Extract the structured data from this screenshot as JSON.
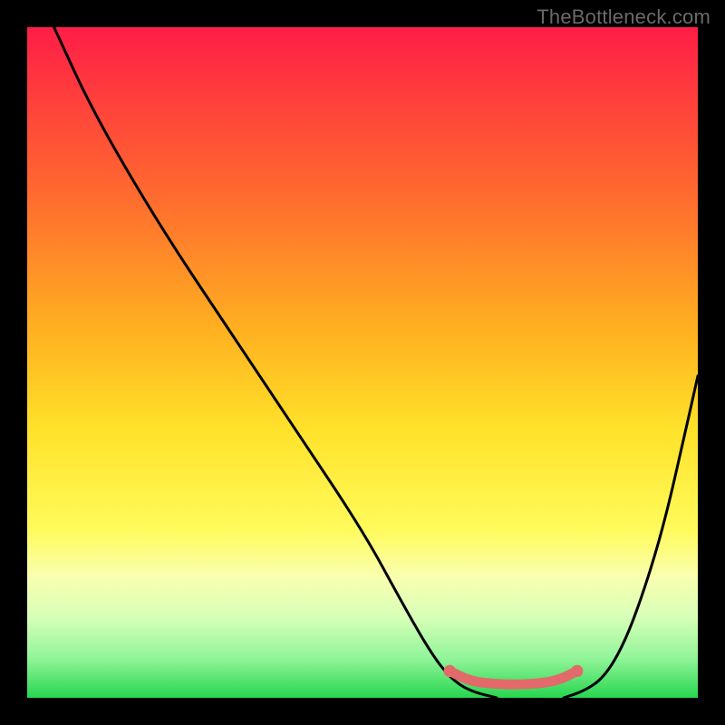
{
  "watermark": "TheBottleneck.com",
  "chart_data": {
    "type": "line",
    "title": "",
    "xlabel": "",
    "ylabel": "",
    "xlim": [
      0,
      100
    ],
    "ylim": [
      0,
      100
    ],
    "grid": false,
    "legend": false,
    "gradient_stops": [
      {
        "pct": 0,
        "color": "#ff1d47"
      },
      {
        "pct": 10,
        "color": "#ff3d3d"
      },
      {
        "pct": 25,
        "color": "#ff6a2f"
      },
      {
        "pct": 45,
        "color": "#ffb020"
      },
      {
        "pct": 60,
        "color": "#ffe22a"
      },
      {
        "pct": 75,
        "color": "#fffb5c"
      },
      {
        "pct": 82,
        "color": "#f9ffb0"
      },
      {
        "pct": 88,
        "color": "#d7ffb8"
      },
      {
        "pct": 94,
        "color": "#93f59a"
      },
      {
        "pct": 100,
        "color": "#27d64f"
      }
    ],
    "series": [
      {
        "name": "left-branch",
        "color": "#000000",
        "points": [
          {
            "x": 4,
            "y": 100
          },
          {
            "x": 10,
            "y": 87
          },
          {
            "x": 20,
            "y": 70
          },
          {
            "x": 30,
            "y": 55
          },
          {
            "x": 40,
            "y": 40
          },
          {
            "x": 50,
            "y": 25
          },
          {
            "x": 56,
            "y": 14
          },
          {
            "x": 60,
            "y": 7
          },
          {
            "x": 63,
            "y": 3
          },
          {
            "x": 66,
            "y": 1
          },
          {
            "x": 70,
            "y": 0
          }
        ]
      },
      {
        "name": "right-branch",
        "color": "#000000",
        "points": [
          {
            "x": 80,
            "y": 0
          },
          {
            "x": 83,
            "y": 1
          },
          {
            "x": 86,
            "y": 3
          },
          {
            "x": 89,
            "y": 8
          },
          {
            "x": 92,
            "y": 16
          },
          {
            "x": 95,
            "y": 26
          },
          {
            "x": 98,
            "y": 39
          },
          {
            "x": 100,
            "y": 48
          }
        ]
      },
      {
        "name": "optimal-range-marker",
        "color": "#e26a6a",
        "points": [
          {
            "x": 63,
            "y": 4
          },
          {
            "x": 66,
            "y": 2.5
          },
          {
            "x": 70,
            "y": 2
          },
          {
            "x": 75,
            "y": 2
          },
          {
            "x": 79,
            "y": 2.5
          },
          {
            "x": 82,
            "y": 4
          }
        ]
      },
      {
        "name": "optimal-endpoint-left",
        "color": "#e26a6a",
        "type": "scatter",
        "points": [
          {
            "x": 63,
            "y": 4
          }
        ]
      },
      {
        "name": "optimal-endpoint-right",
        "color": "#e26a6a",
        "type": "scatter",
        "points": [
          {
            "x": 82,
            "y": 4
          }
        ]
      }
    ]
  }
}
